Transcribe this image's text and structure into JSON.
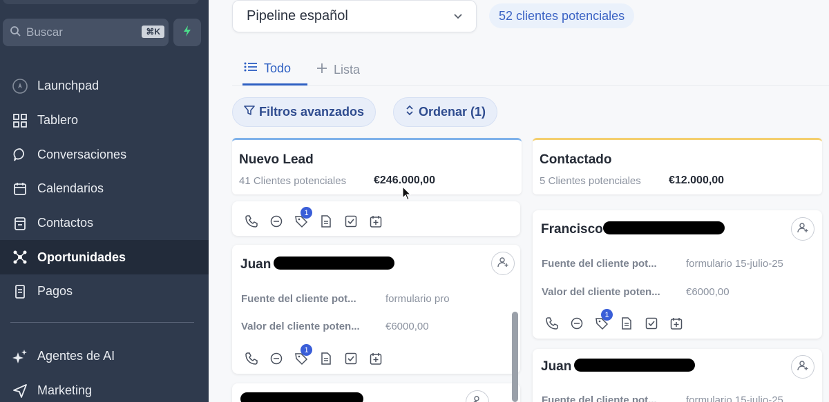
{
  "sidebar": {
    "search_placeholder": "Buscar",
    "search_shortcut": "⌘K",
    "items": [
      {
        "label": "Launchpad",
        "icon": "rocket-icon"
      },
      {
        "label": "Tablero",
        "icon": "dashboard-icon"
      },
      {
        "label": "Conversaciones",
        "icon": "chat-icon"
      },
      {
        "label": "Calendarios",
        "icon": "calendar-icon"
      },
      {
        "label": "Contactos",
        "icon": "contacts-icon"
      },
      {
        "label": "Oportunidades",
        "icon": "opportunities-icon"
      },
      {
        "label": "Pagos",
        "icon": "payments-icon"
      }
    ],
    "items2": [
      {
        "label": "Agentes de AI",
        "icon": "sparkle-icon"
      },
      {
        "label": "Marketing",
        "icon": "send-icon"
      }
    ]
  },
  "header": {
    "pipeline": "Pipeline español",
    "leads_count": "52 clientes potenciales"
  },
  "tabs": {
    "all": "Todo",
    "add_list": "Lista"
  },
  "filters": {
    "advanced": "Filtros avanzados",
    "sort": "Ordenar (1)"
  },
  "columns": [
    {
      "title": "Nuevo Lead",
      "count": "41 Clientes potenciales",
      "amount": "€246.000,00",
      "cards": [
        {
          "name": "Juan",
          "source_label": "Fuente del cliente pot...",
          "source_value": "formulario pro",
          "value_label": "Valor del cliente poten...",
          "value_value": "€6000,00",
          "badge": "1"
        }
      ],
      "top_badge": "1"
    },
    {
      "title": "Contactado",
      "count": "5 Clientes potenciales",
      "amount": "€12.000,00",
      "cards": [
        {
          "name": "Francisco",
          "source_label": "Fuente del cliente pot...",
          "source_value": "formulario 15-julio-25",
          "value_label": "Valor del cliente poten...",
          "value_value": "€6000,00",
          "badge": "1"
        },
        {
          "name": "Juan",
          "source_label": "Fuente del cliente pot...",
          "source_value": "formulario 15-julio-25"
        }
      ]
    }
  ],
  "colors": {
    "accent": "#2d5fc2",
    "sidebar": "#2f3a4d",
    "badge": "#3a5ed8"
  }
}
